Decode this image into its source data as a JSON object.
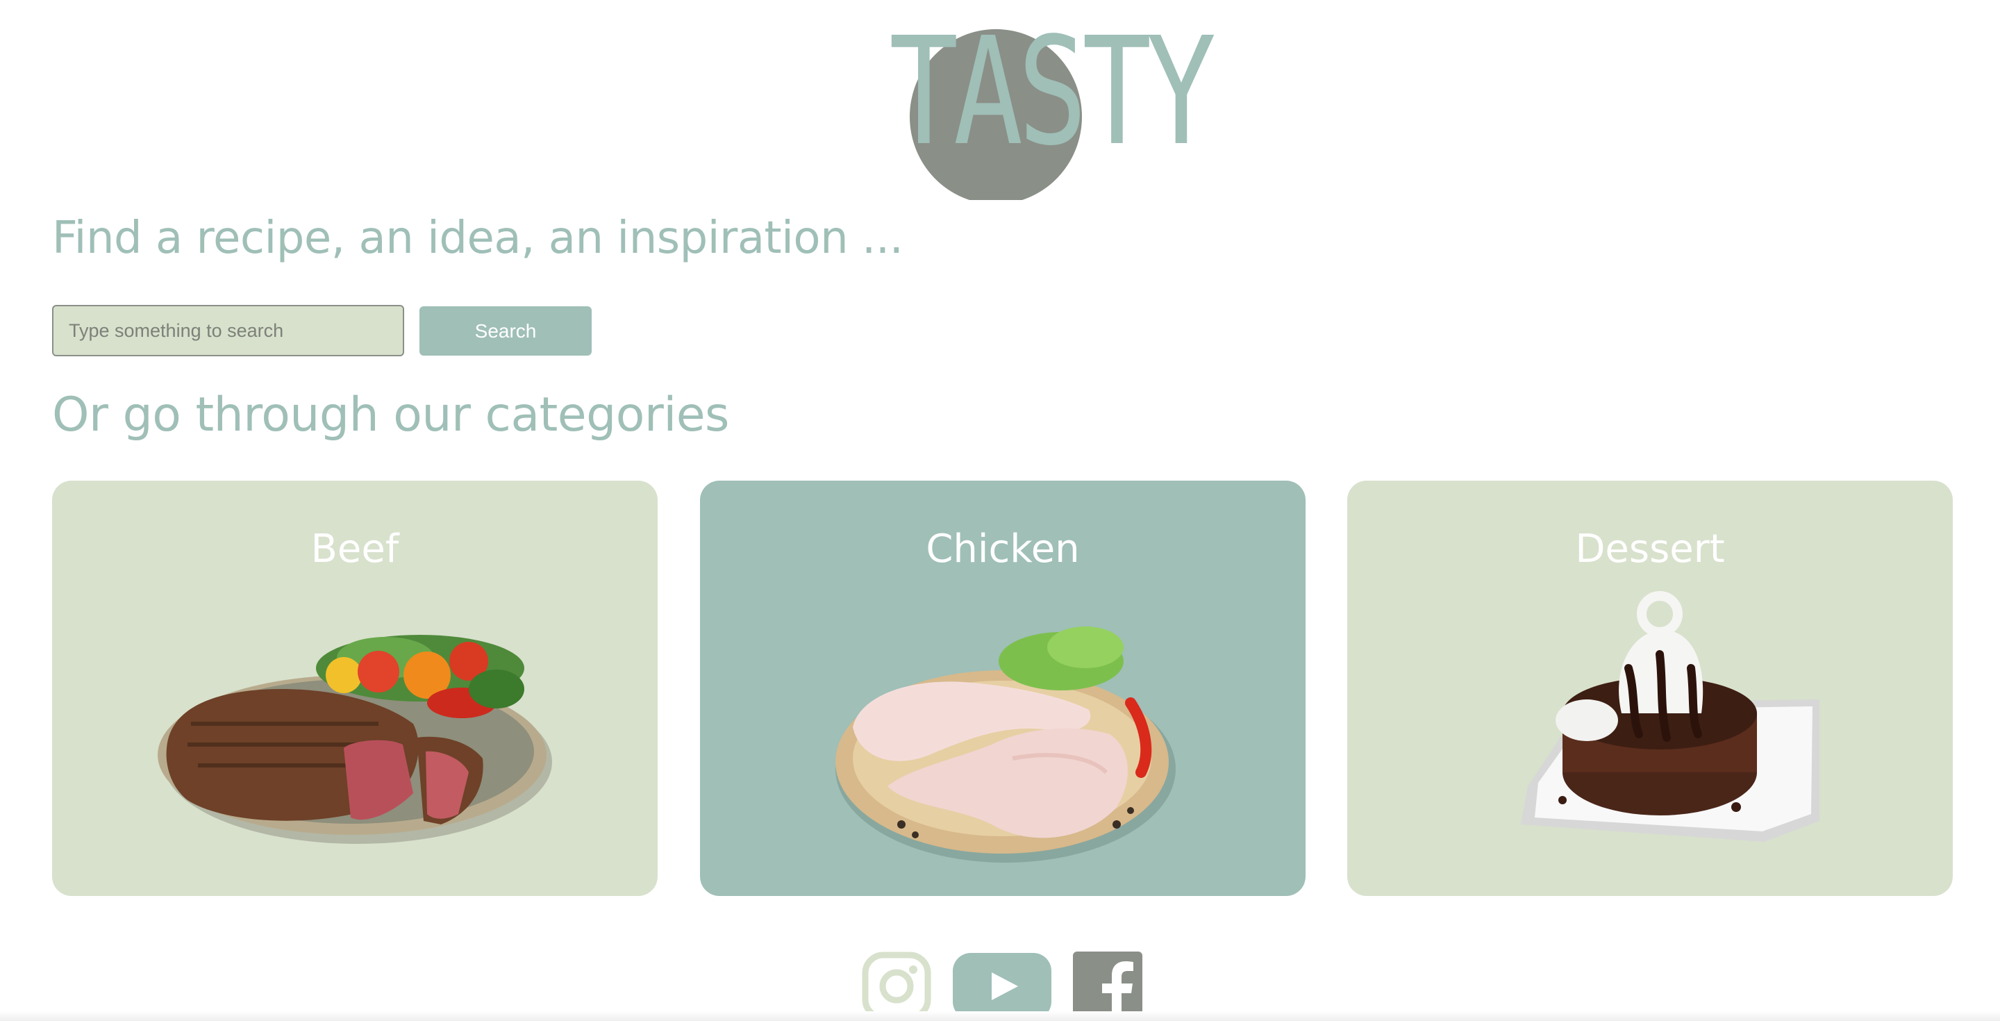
{
  "brand": {
    "logo_text": "TASTY",
    "colors": {
      "primary": "#9fbfb7",
      "light": "#d8e1cc",
      "dark": "#8a8f88",
      "white": "#ffffff"
    }
  },
  "hero": {
    "heading": "Find a recipe, an idea, an inspiration ..."
  },
  "search": {
    "placeholder": "Type something to search",
    "value": "",
    "button_label": "Search"
  },
  "categories": {
    "heading": "Or go through our categories",
    "items": [
      {
        "label": "Beef",
        "icon": "beef-steak-image"
      },
      {
        "label": "Chicken",
        "icon": "chicken-legs-image"
      },
      {
        "label": "Dessert",
        "icon": "chocolate-dessert-image"
      }
    ]
  },
  "social": {
    "items": [
      {
        "name": "instagram",
        "icon": "instagram-icon"
      },
      {
        "name": "youtube",
        "icon": "youtube-icon"
      },
      {
        "name": "facebook",
        "icon": "facebook-icon"
      }
    ]
  }
}
